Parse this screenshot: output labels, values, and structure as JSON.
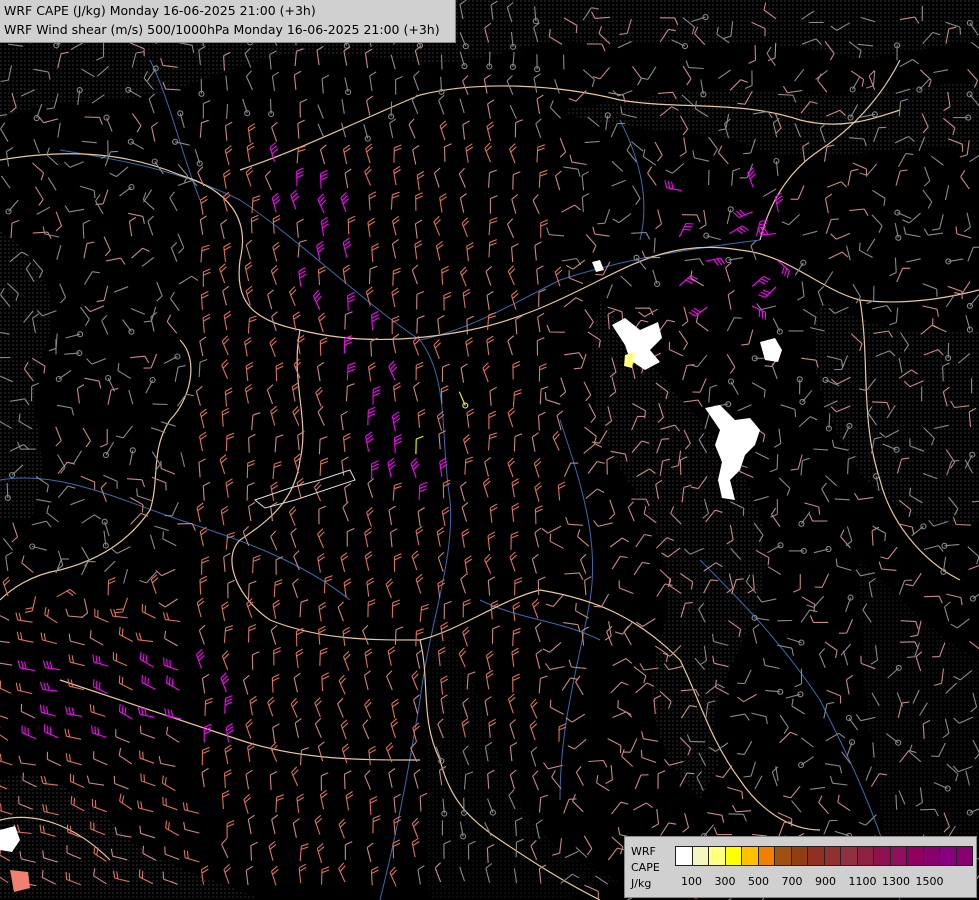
{
  "title": {
    "line1": "WRF CAPE (J/kg) Monday 16-06-2025 21:00 (+3h)",
    "line2": "WRF Wind shear (m/s) 500/1000hPa Monday 16-06-2025 21:00 (+3h)"
  },
  "legend": {
    "label_model": "WRF",
    "label_field": "CAPE",
    "label_unit": "J/kg",
    "colors": [
      "#ffffff",
      "#f5f5c0",
      "#ffff80",
      "#ffff00",
      "#ffc000",
      "#f08000",
      "#a05010",
      "#904010",
      "#903020",
      "#903030",
      "#903040",
      "#902040",
      "#901050",
      "#901060",
      "#900060",
      "#880070",
      "#880080",
      "#880070"
    ],
    "ticks": [
      "100",
      "300",
      "500",
      "700",
      "900",
      "1100",
      "1300",
      "1500"
    ]
  },
  "map": {
    "background": "#000000",
    "barb_colors": {
      "weak": "#8a8a8a",
      "moderate": "#cc8888",
      "strong": "#e07060",
      "very_strong": "#ff00ff",
      "cape_marker": "#ffff00"
    },
    "border_color": "#e8c7a0",
    "river_color": "#3a6ab0",
    "terrain_dots": "#9a9a9a"
  }
}
